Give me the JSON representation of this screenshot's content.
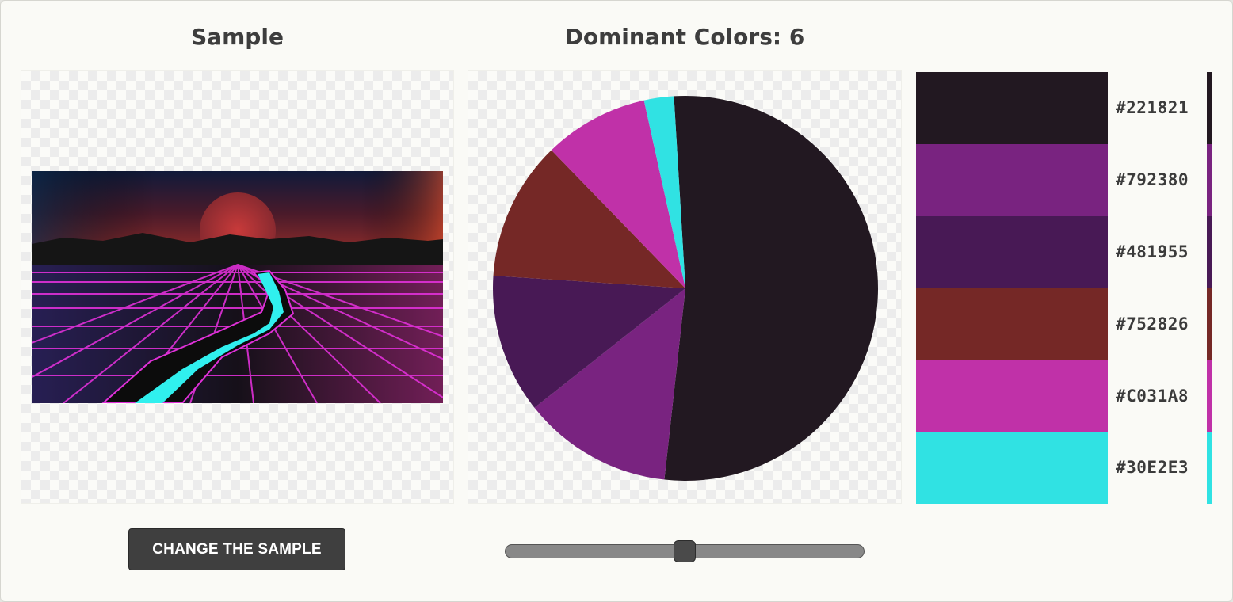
{
  "sample": {
    "heading": "Sample",
    "button_label": "CHANGE THE SAMPLE",
    "image_icon": "synthwave-grid-landscape-image"
  },
  "dominant": {
    "heading": "Dominant Colors: 6",
    "slider_value": 0.5,
    "colors": [
      {
        "hex": "#221821",
        "label": "#221821",
        "fraction": 0.527
      },
      {
        "hex": "#792380",
        "label": "#792380",
        "fraction": 0.126
      },
      {
        "hex": "#481955",
        "label": "#481955",
        "fraction": 0.117
      },
      {
        "hex": "#752826",
        "label": "#752826",
        "fraction": 0.117
      },
      {
        "hex": "#C031A8",
        "label": "#C031A8",
        "fraction": 0.088
      },
      {
        "hex": "#30E2E3",
        "label": "#30E2E3",
        "fraction": 0.025
      }
    ]
  }
}
